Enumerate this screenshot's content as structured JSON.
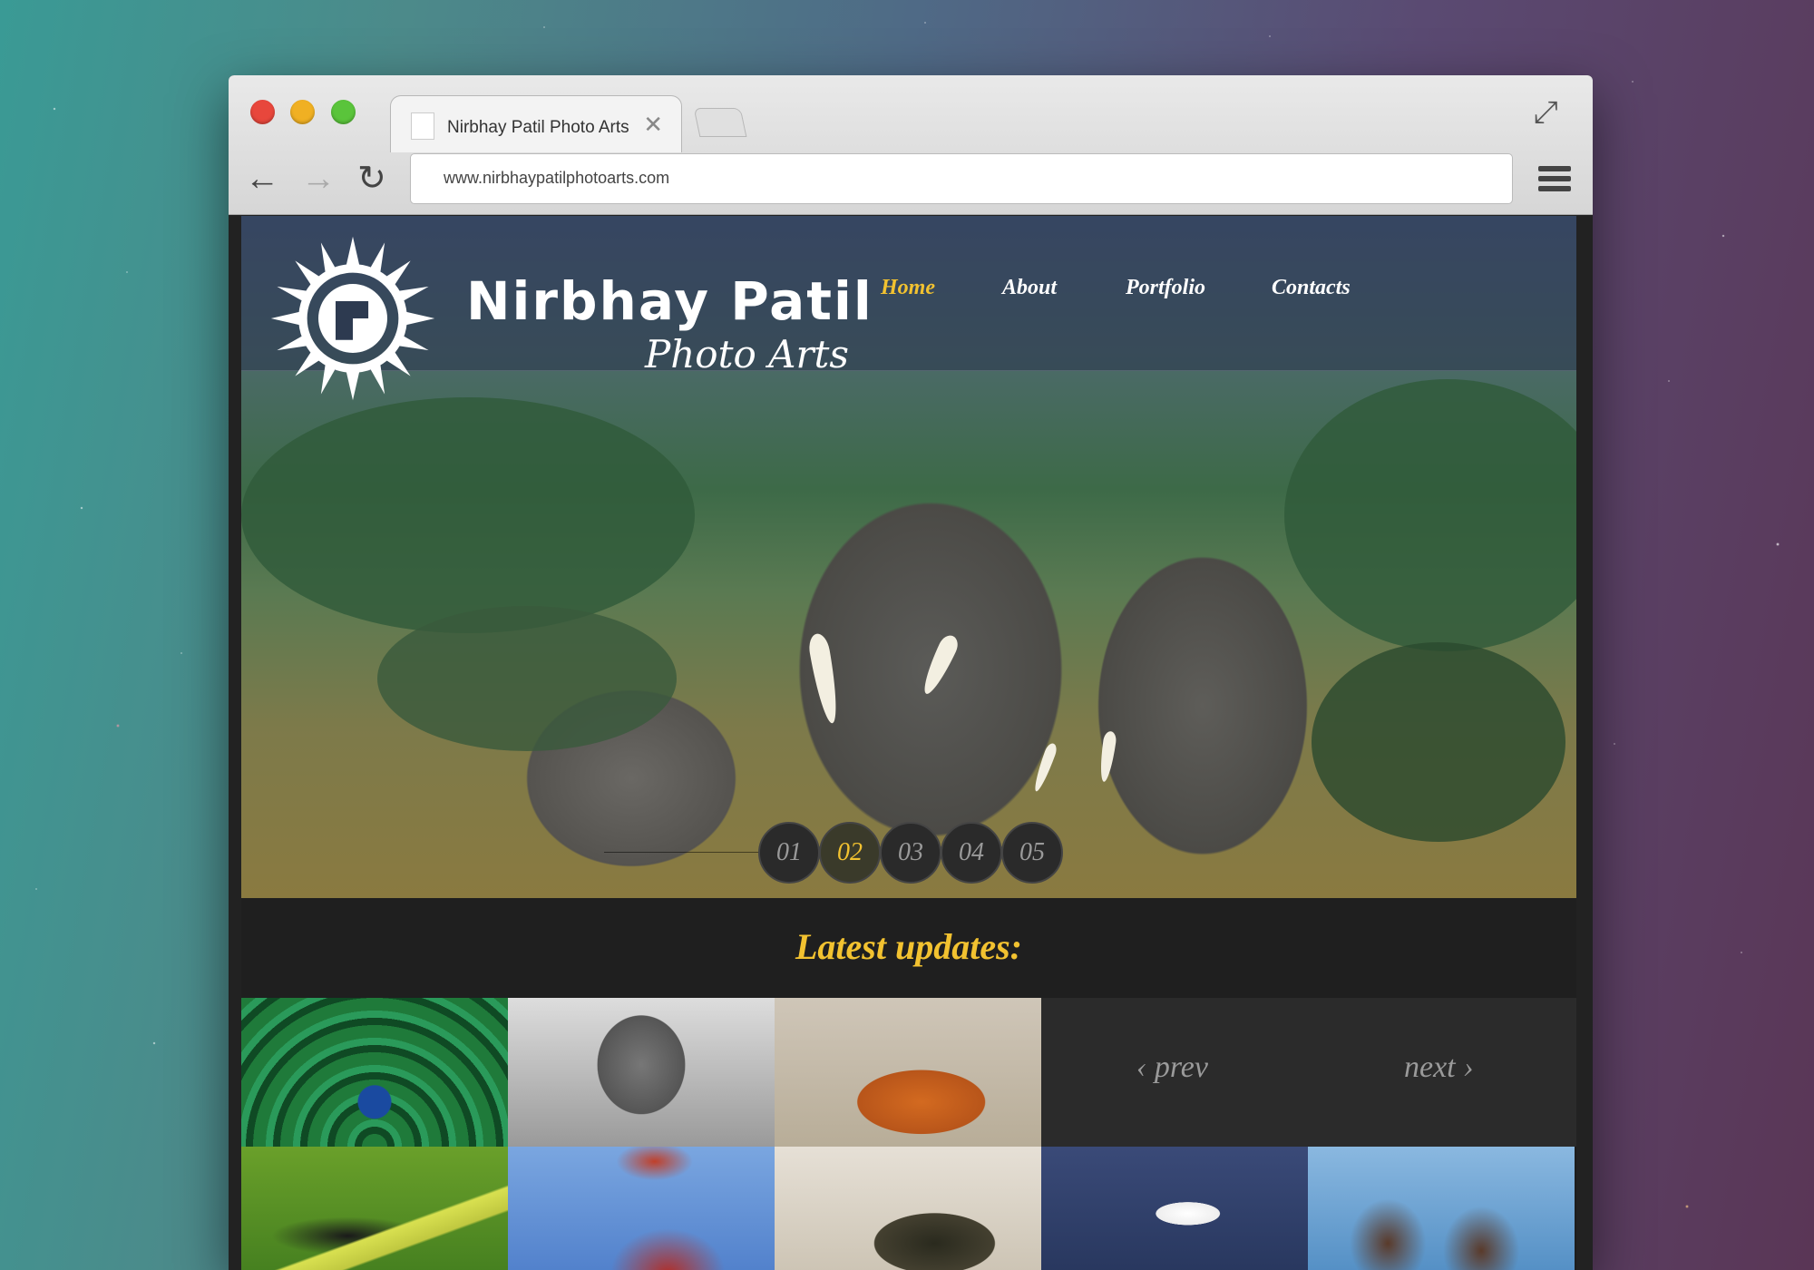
{
  "browser": {
    "tab_title": "Nirbhay Patil Photo Arts",
    "tab_close": "✕",
    "url": "www.nirbhaypatilphotoarts.com",
    "back": "←",
    "forward": "→",
    "reload": "↻",
    "expand": "⤢"
  },
  "site": {
    "brand_name": "Nirbhay Patil",
    "brand_sub": "Photo Arts",
    "nav": [
      "Home",
      "About",
      "Portfolio",
      "Contacts"
    ],
    "slides": [
      "01",
      "02",
      "03",
      "04",
      "05"
    ],
    "active_slide": "02",
    "updates_heading": "Latest updates:",
    "pager": {
      "prev": "‹ prev",
      "next": "next ›"
    }
  },
  "colors": {
    "accent": "#f2c230"
  }
}
